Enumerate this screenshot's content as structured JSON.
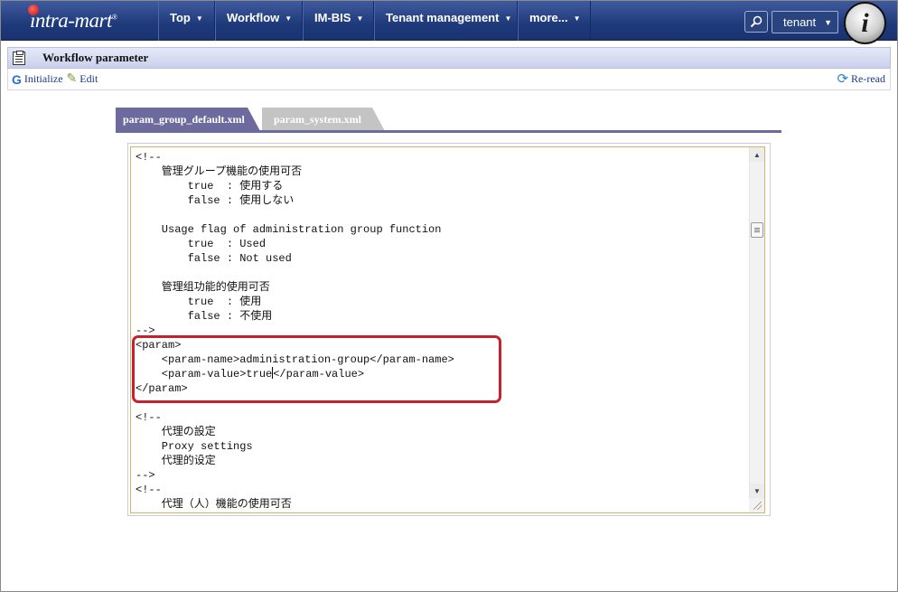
{
  "app": {
    "logo_text": "intra-mart",
    "logo_mark": "®",
    "menu": [
      {
        "label": "Top",
        "width": 63
      },
      {
        "label": "Workflow",
        "width": 97
      },
      {
        "label": "IM-BIS",
        "width": 79
      },
      {
        "label": "Tenant management",
        "width": 159
      },
      {
        "label": "more...",
        "width": 81
      }
    ],
    "search_icon": "search-icon",
    "tenant_label": "tenant",
    "user_icon_letter": "i"
  },
  "page": {
    "title": "Workflow parameter",
    "toolbar": {
      "initialize_label": "Initialize",
      "edit_label": "Edit",
      "reread_label": "Re-read"
    },
    "tabs": [
      {
        "label": "param_group_default.xml",
        "active": true
      },
      {
        "label": "param_system.xml",
        "active": false
      }
    ]
  },
  "editor": {
    "lines": [
      "<!--",
      "    管理グループ機能の使用可否",
      "        true  : 使用する",
      "        false : 使用しない",
      "",
      "    Usage flag of administration group function",
      "        true  : Used",
      "        false : Not used",
      "",
      "    管理组功能的使用可否",
      "        true  : 使用",
      "        false : 不使用",
      "-->",
      "<param>",
      "    <param-name>administration-group</param-name>",
      "    <param-value>true|</param-value>",
      "</param>",
      "",
      "<!--",
      "    代理の設定",
      "    Proxy settings",
      "    代理的设定",
      "-->",
      "<!--",
      "    代理（人）機能の使用可否"
    ],
    "highlight_color": "#c8202c"
  },
  "colors": {
    "topbar": "#1f3a7a",
    "tab_active": "#6d6a9e",
    "tab_inactive": "#c4c4c4"
  }
}
